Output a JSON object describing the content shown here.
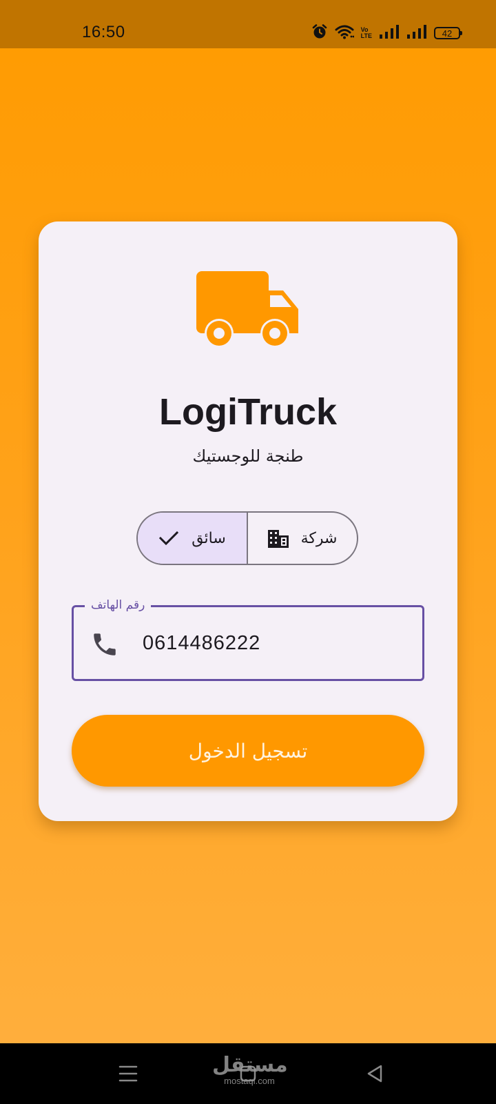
{
  "status_bar": {
    "time": "16:50",
    "volte_line1": "Vo",
    "volte_line2": "LTE",
    "battery": "42",
    "icons": [
      "alarm-icon",
      "wifi-icon",
      "volte-icon",
      "signal-icon",
      "signal-icon",
      "battery-icon"
    ]
  },
  "card": {
    "logo_icon": "truck-icon",
    "title": "LogiTruck",
    "subtitle": "طنجة للوجستيك"
  },
  "role_selector": {
    "options": [
      {
        "label": "سائق",
        "icon": "check-icon",
        "selected": true
      },
      {
        "label": "شركة",
        "icon": "building-icon",
        "selected": false
      }
    ]
  },
  "phone_field": {
    "label": "رقم الهاتف",
    "value": "0614486222",
    "icon": "phone-icon"
  },
  "login_button": {
    "label": "تسجيل الدخول"
  },
  "watermark": {
    "arabic": "مستقل",
    "latin": "mostaql.com"
  },
  "colors": {
    "accent": "#ff9800",
    "status_bar": "#c07400",
    "card_bg": "#f5f0f7",
    "field_border": "#6750a4",
    "selected_segment": "#e8def8",
    "nav_bar": "#000000"
  }
}
